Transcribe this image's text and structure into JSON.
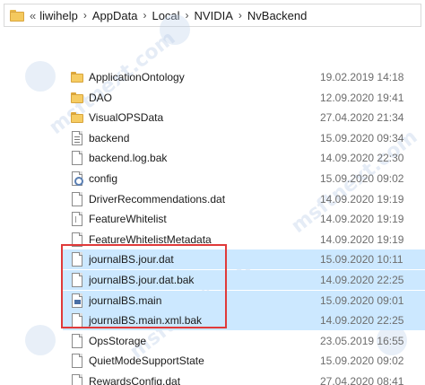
{
  "address": {
    "prefix": "«",
    "crumbs": [
      "liwihelp",
      "AppData",
      "Local",
      "NVIDIA",
      "NvBackend"
    ],
    "separator": "›"
  },
  "watermark_text": "msftnext.com",
  "files": [
    {
      "name": "ApplicationOntology",
      "date": "19.02.2019 14:18",
      "icon": "folder-icon",
      "selected": false
    },
    {
      "name": "DAO",
      "date": "12.09.2020 19:41",
      "icon": "folder-icon",
      "selected": false
    },
    {
      "name": "VisualOPSData",
      "date": "27.04.2020 21:34",
      "icon": "folder-icon",
      "selected": false
    },
    {
      "name": "backend",
      "date": "15.09.2020 09:34",
      "icon": "text-file-icon",
      "selected": false
    },
    {
      "name": "backend.log.bak",
      "date": "14.09.2020 22:30",
      "icon": "file-icon",
      "selected": false
    },
    {
      "name": "config",
      "date": "15.09.2020 09:02",
      "icon": "settings-file-icon",
      "selected": false
    },
    {
      "name": "DriverRecommendations.dat",
      "date": "14.09.2020 19:19",
      "icon": "file-icon",
      "selected": false
    },
    {
      "name": "FeatureWhitelist",
      "date": "14.09.2020 19:19",
      "icon": "document-file-icon",
      "selected": false
    },
    {
      "name": "FeatureWhitelistMetadata",
      "date": "14.09.2020 19:19",
      "icon": "file-icon",
      "selected": false
    },
    {
      "name": "journalBS.jour.dat",
      "date": "15.09.2020 10:11",
      "icon": "file-icon",
      "selected": true
    },
    {
      "name": "journalBS.jour.dat.bak",
      "date": "14.09.2020 22:25",
      "icon": "file-icon",
      "selected": true
    },
    {
      "name": "journalBS.main",
      "date": "15.09.2020 09:01",
      "icon": "system-file-icon",
      "selected": true
    },
    {
      "name": "journalBS.main.xml.bak",
      "date": "14.09.2020 22:25",
      "icon": "file-icon",
      "selected": true
    },
    {
      "name": "OpsStorage",
      "date": "23.05.2019 16:55",
      "icon": "file-icon",
      "selected": false
    },
    {
      "name": "QuietModeSupportState",
      "date": "15.09.2020 09:02",
      "icon": "file-icon",
      "selected": false
    },
    {
      "name": "RewardsConfig.dat",
      "date": "27.04.2020 08:41",
      "icon": "file-icon",
      "selected": false
    }
  ],
  "colors": {
    "selection": "#cce8ff",
    "highlight_border": "#e03a3a",
    "folder": "#f6cc63"
  }
}
